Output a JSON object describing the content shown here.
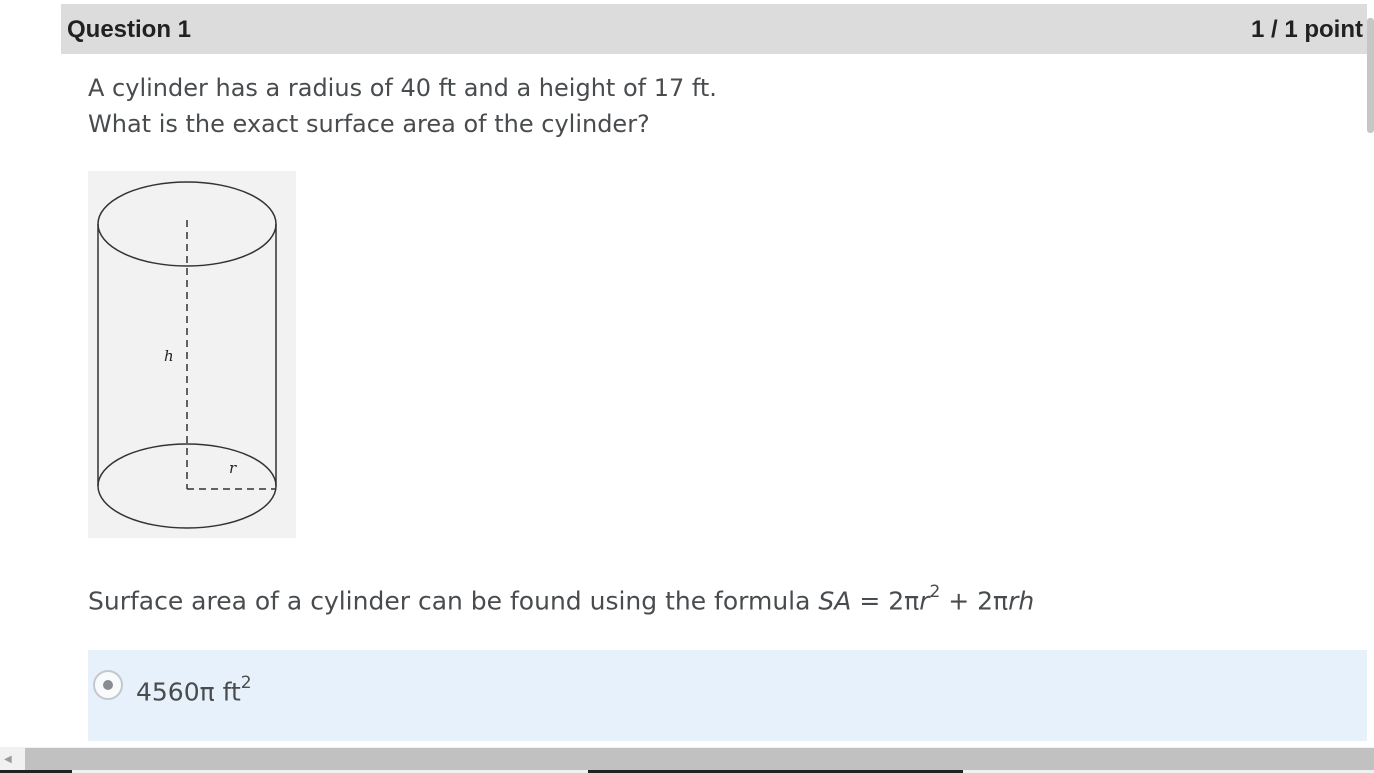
{
  "question": {
    "title": "Question 1",
    "points": "1 / 1 point",
    "stem_line1": "A cylinder has a radius of 40 ft and a height of 17 ft.",
    "stem_line2": "What is the exact surface area of the cylinder?"
  },
  "figure": {
    "height_label": "h",
    "radius_label": "r"
  },
  "formula": {
    "prefix": "Surface area of a cylinder can be found using the formula ",
    "sa": "SA",
    "eq": " = 2π",
    "r": "r",
    "exp": "2",
    "plus": " + 2π",
    "rh": "rh"
  },
  "answer": {
    "value": "4560π ft",
    "exp": "2",
    "selected": true
  },
  "colors": {
    "header_bg": "#dcdcdc",
    "answer_bg": "#e6f1fb"
  }
}
